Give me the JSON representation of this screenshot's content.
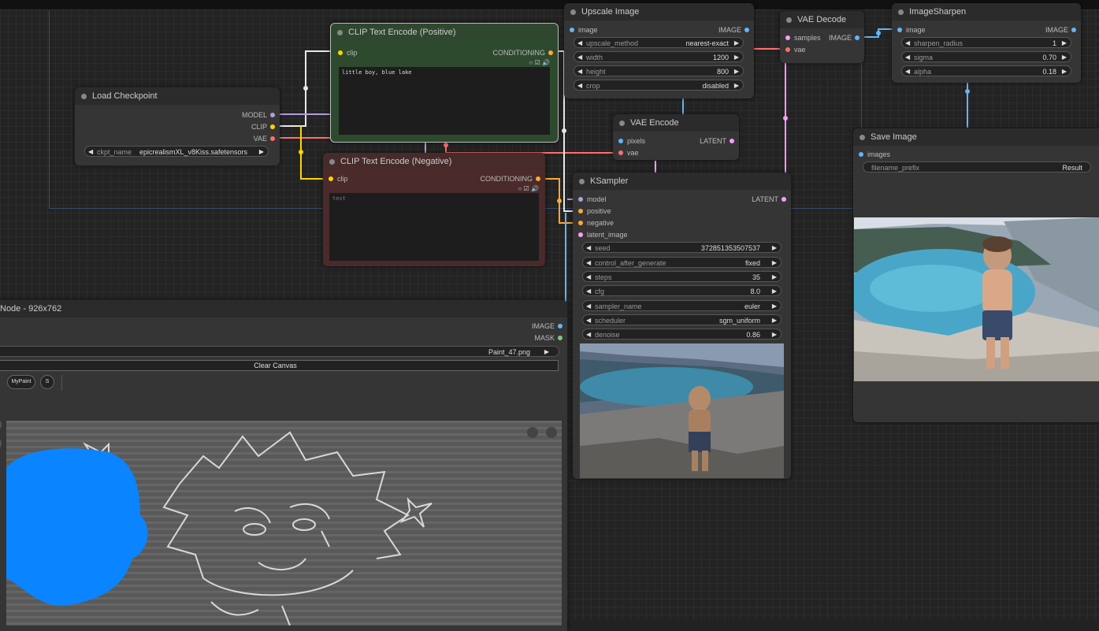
{
  "nodes": {
    "load_checkpoint": {
      "title": "Load Checkpoint",
      "outputs": [
        "MODEL",
        "CLIP",
        "VAE"
      ],
      "ckpt_label": "ckpt_name",
      "ckpt_value": "epicrealismXL_v8Kiss.safetensors"
    },
    "clip_positive": {
      "title": "CLIP Text Encode (Positive)",
      "input": "clip",
      "output": "CONDITIONING",
      "text": "little boy, blue lake"
    },
    "clip_negative": {
      "title": "CLIP Text Encode (Negative)",
      "input": "clip",
      "output": "CONDITIONING",
      "placeholder": "text"
    },
    "upscale_image": {
      "title": "Upscale Image",
      "input": "image",
      "output": "IMAGE",
      "widgets": [
        {
          "label": "upscale_method",
          "value": "nearest-exact"
        },
        {
          "label": "width",
          "value": "1200"
        },
        {
          "label": "height",
          "value": "800"
        },
        {
          "label": "crop",
          "value": "disabled"
        }
      ]
    },
    "vae_decode": {
      "title": "VAE Decode",
      "inputs": [
        "samples",
        "vae"
      ],
      "output": "IMAGE"
    },
    "image_sharpen": {
      "title": "ImageSharpen",
      "input": "image",
      "output": "IMAGE",
      "widgets": [
        {
          "label": "sharpen_radius",
          "value": "1"
        },
        {
          "label": "sigma",
          "value": "0.70"
        },
        {
          "label": "alpha",
          "value": "0.18"
        }
      ]
    },
    "vae_encode": {
      "title": "VAE Encode",
      "inputs": [
        "pixels",
        "vae"
      ],
      "output": "LATENT"
    },
    "ksampler": {
      "title": "KSampler",
      "inputs": [
        "model",
        "positive",
        "negative",
        "latent_image"
      ],
      "output": "LATENT",
      "widgets": [
        {
          "label": "seed",
          "value": "372851353507537"
        },
        {
          "label": "control_after_generate",
          "value": "fixed"
        },
        {
          "label": "steps",
          "value": "35"
        },
        {
          "label": "cfg",
          "value": "8.0"
        },
        {
          "label": "sampler_name",
          "value": "euler"
        },
        {
          "label": "scheduler",
          "value": "sgm_uniform"
        },
        {
          "label": "denoise",
          "value": "0.86"
        }
      ]
    },
    "save_image": {
      "title": "Save Image",
      "input": "images",
      "prefix_label": "filename_prefix",
      "prefix_value": "Result"
    },
    "paint_node": {
      "title": "Node - 926x762",
      "outputs": [
        "IMAGE",
        "MASK"
      ],
      "file_value": "Paint_47.png",
      "clear_label": "Clear Canvas",
      "mypaint_label": "MyPaint",
      "s_label": "S"
    }
  },
  "colors": {
    "model": "#b39ddb",
    "clip": "#ffd500",
    "vae": "#ff6e6e",
    "conditioning": "#ffa931",
    "image": "#64b5f6",
    "latent": "#ff9cf9",
    "mask": "#81c784",
    "positive_node": "#2e4a2e",
    "negative_node": "#4a2a2a"
  }
}
